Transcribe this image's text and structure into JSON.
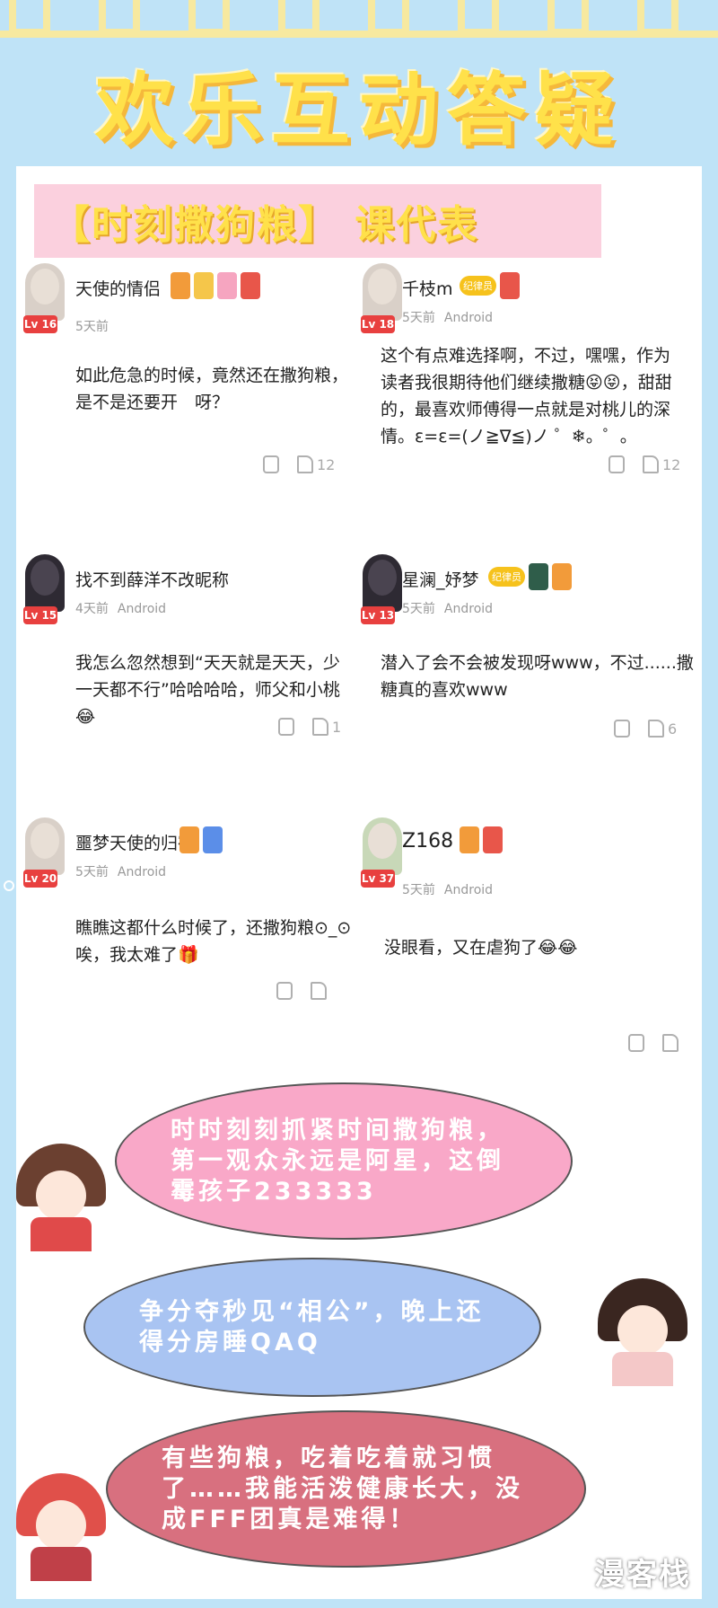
{
  "header": {
    "title": "欢乐互动答疑"
  },
  "banner": {
    "text": "【时刻撒狗粮】 课代表"
  },
  "comments": [
    {
      "user": "天使的情侣",
      "level": "Lv 16",
      "time": "5天前",
      "platform": "",
      "text": "如此危急的时候，竟然还在撒狗粮，是不是还要开　呀？",
      "likes": "12",
      "tag": ""
    },
    {
      "user": "千枝m",
      "level": "Lv 18",
      "time": "5天前",
      "platform": "Android",
      "text": "这个有点难选择啊，不过，嘿嘿，作为读者我很期待他们继续撒糖😝😝，甜甜的，最喜欢师傅得一点就是对桃儿的深情。ε=ε=(ノ≧∇≦)ノ ゜❄。゜。",
      "likes": "12",
      "tag": "纪律员"
    },
    {
      "user": "找不到薛洋不改昵称",
      "level": "Lv 15",
      "time": "4天前",
      "platform": "Android",
      "text": "我怎么忽然想到“天天就是天天，少一天都不行”哈哈哈哈，师父和小桃😂",
      "likes": "1",
      "tag": ""
    },
    {
      "user": "星澜_妤梦",
      "level": "Lv 13",
      "time": "5天前",
      "platform": "Android",
      "text": "潜入了会不会被发现呀www，不过......撒糖真的喜欢www",
      "likes": "6",
      "tag": "纪律员"
    },
    {
      "user": "噩梦天使的归宿",
      "level": "Lv 20",
      "time": "5天前",
      "platform": "Android",
      "text": "瞧瞧这都什么时候了，还撒狗粮⊙_⊙唉，我太难了🎁",
      "likes": "",
      "tag": ""
    },
    {
      "user": "Z168",
      "level": "Lv 37",
      "time": "5天前",
      "platform": "Android",
      "text": "没眼看，又在虐狗了😂😂",
      "likes": "",
      "tag": ""
    }
  ],
  "bubbles": [
    {
      "text": "时时刻刻抓紧时间撒狗粮，第一观众永远是阿星，这倒霉孩子233333"
    },
    {
      "text": "争分夺秒见“相公”，晚上还得分房睡QAQ"
    },
    {
      "text": "有些狗粮，吃着吃着就习惯了……我能活泼健康长大，没成FFF团真是难得！"
    }
  ],
  "logo": {
    "text": "漫客栈"
  },
  "colors": {
    "background": "#bfe3f7",
    "title": "#ffe14a",
    "banner_bg": "#fbd0de",
    "level_badge": "#e8403f",
    "bubble1": "#f9a8c8",
    "bubble2": "#a9c4f2",
    "bubble3": "#d8707f"
  }
}
